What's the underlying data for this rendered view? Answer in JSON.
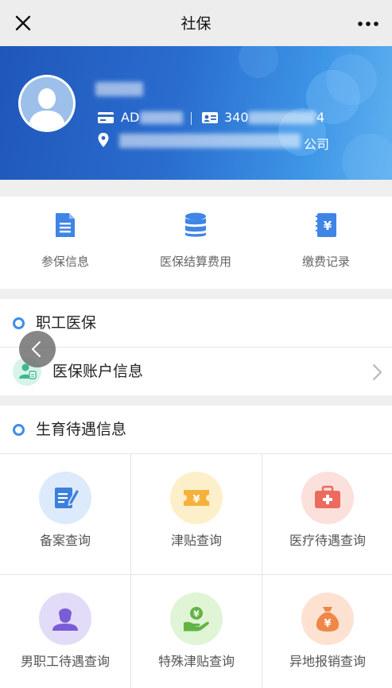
{
  "nav": {
    "title": "社保"
  },
  "profile": {
    "id_prefix": "AD",
    "idcard_prefix": "340",
    "idcard_suffix": "4",
    "company_suffix": "公司"
  },
  "quick_actions": [
    {
      "label": "参保信息",
      "icon": "document-icon"
    },
    {
      "label": "医保结算费用",
      "icon": "database-icon"
    },
    {
      "label": "缴费记录",
      "icon": "receipt-yuan-icon"
    }
  ],
  "employee_medical": {
    "title": "职工医保",
    "account_row": {
      "label": "医保账户信息"
    }
  },
  "maternity": {
    "title": "生育待遇信息",
    "items": [
      {
        "label": "备案查询",
        "icon": "edit-form-icon",
        "color": "#3d7fdd",
        "bg": "#dceafb"
      },
      {
        "label": "津贴查询",
        "icon": "ticket-yuan-icon",
        "color": "#f5b13c",
        "bg": "#fdefc9"
      },
      {
        "label": "医疗待遇查询",
        "icon": "medical-kit-icon",
        "color": "#ec6a5e",
        "bg": "#fbe0dc"
      },
      {
        "label": "男职工待遇查询",
        "icon": "male-user-icon",
        "color": "#7a5dd6",
        "bg": "#e3dcf8"
      },
      {
        "label": "特殊津贴查询",
        "icon": "hand-coin-icon",
        "color": "#62b444",
        "bg": "#e0f4d6"
      },
      {
        "label": "异地报销查询",
        "icon": "money-bag-icon",
        "color": "#ee8748",
        "bg": "#fde2d2"
      }
    ]
  }
}
